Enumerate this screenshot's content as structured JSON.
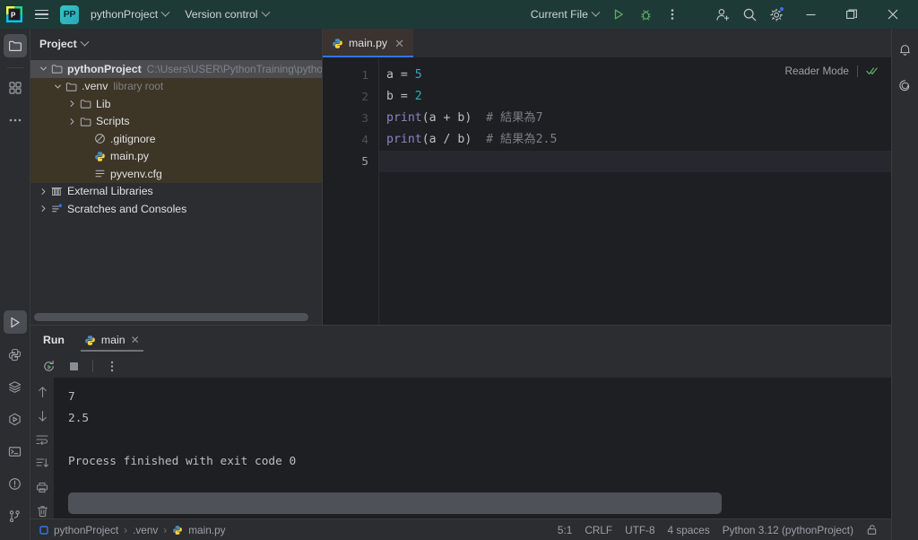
{
  "titlebar": {
    "app_icon": "pycharm-logo-icon",
    "menu_icon": "hamburger-menu-icon",
    "project_badge": "PP",
    "project_name": "pythonProject",
    "version_control": "Version control",
    "run_config": "Current File",
    "run_icon": "run-icon",
    "debug_icon": "debug-icon",
    "more_icon": "more-vertical-icon",
    "account_icon": "add-user-icon",
    "search_icon": "search-icon",
    "settings_icon": "gear-icon",
    "minimize_icon": "minimize-icon",
    "maximize_icon": "maximize-icon",
    "close_icon": "close-icon",
    "accent": "#3574f0",
    "bg": "#1e3a37"
  },
  "left_rail": {
    "top": [
      {
        "name": "project-icon",
        "label": "Project",
        "active": true
      },
      {
        "name": "structure-icon",
        "label": "Structure",
        "active": false
      },
      {
        "name": "more-tools-icon",
        "label": "More tool windows",
        "active": false
      }
    ],
    "bottom": [
      {
        "name": "run-tool-icon",
        "label": "Run",
        "active": true
      },
      {
        "name": "python-console-icon",
        "label": "Python Console",
        "active": false
      },
      {
        "name": "database-icon",
        "label": "Database",
        "active": false
      },
      {
        "name": "services-icon",
        "label": "Services",
        "active": false
      },
      {
        "name": "terminal-icon",
        "label": "Terminal",
        "active": false
      },
      {
        "name": "problems-icon",
        "label": "Problems",
        "active": false
      },
      {
        "name": "version-control-icon",
        "label": "Version Control",
        "active": false
      }
    ]
  },
  "right_rail": [
    {
      "name": "notifications-bell-icon",
      "label": "Notifications"
    },
    {
      "name": "ai-assistant-icon",
      "label": "AI Assistant"
    }
  ],
  "project_panel": {
    "title": "Project",
    "tree": [
      {
        "name": "pythonProject",
        "detail": "C:\\Users\\USER\\PythonTraining\\pythonProject",
        "icon": "folder-icon",
        "indent": 0,
        "expanded": true,
        "selected": true,
        "tint": false
      },
      {
        "name": ".venv",
        "detail": "library root",
        "icon": "folder-icon",
        "indent": 1,
        "expanded": true,
        "selected": false,
        "tint": true
      },
      {
        "name": "Lib",
        "detail": "",
        "icon": "folder-icon",
        "indent": 2,
        "expanded": false,
        "selected": false,
        "tint": true
      },
      {
        "name": "Scripts",
        "detail": "",
        "icon": "folder-icon",
        "indent": 2,
        "expanded": false,
        "selected": false,
        "tint": true
      },
      {
        "name": ".gitignore",
        "detail": "",
        "icon": "gitignore-icon",
        "indent": 3,
        "expanded": null,
        "selected": false,
        "tint": true
      },
      {
        "name": "main.py",
        "detail": "",
        "icon": "python-file-icon",
        "indent": 3,
        "expanded": null,
        "selected": false,
        "tint": true
      },
      {
        "name": "pyvenv.cfg",
        "detail": "",
        "icon": "config-file-icon",
        "indent": 3,
        "expanded": null,
        "selected": false,
        "tint": true
      },
      {
        "name": "External Libraries",
        "detail": "",
        "icon": "libraries-icon",
        "indent": 0,
        "expanded": false,
        "selected": false,
        "tint": false
      },
      {
        "name": "Scratches and Consoles",
        "detail": "",
        "icon": "scratches-icon",
        "indent": 0,
        "expanded": false,
        "selected": false,
        "tint": false
      }
    ]
  },
  "editor": {
    "tab": {
      "label": "main.py",
      "icon": "python-file-icon",
      "close_icon": "close-icon",
      "active": true
    },
    "reader_mode": "Reader Mode",
    "inspection_icon": "inspections-ok-icon",
    "line_numbers": [
      "1",
      "2",
      "3",
      "4",
      "5"
    ],
    "current_line": 5,
    "lines": [
      {
        "n": 1,
        "tokens": [
          {
            "t": "a = ",
            "c": "plain"
          },
          {
            "t": "5",
            "c": "num"
          }
        ]
      },
      {
        "n": 2,
        "tokens": [
          {
            "t": "b = ",
            "c": "plain"
          },
          {
            "t": "2",
            "c": "num"
          }
        ]
      },
      {
        "n": 3,
        "tokens": [
          {
            "t": "print",
            "c": "kw"
          },
          {
            "t": "(a + b)  ",
            "c": "plain"
          },
          {
            "t": "# 結果為7",
            "c": "cmt"
          }
        ]
      },
      {
        "n": 4,
        "tokens": [
          {
            "t": "print",
            "c": "kw"
          },
          {
            "t": "(a / b)  ",
            "c": "plain"
          },
          {
            "t": "# 結果為2.5",
            "c": "cmt"
          }
        ]
      },
      {
        "n": 5,
        "tokens": [
          {
            "t": "",
            "c": "plain"
          }
        ]
      }
    ]
  },
  "run_panel": {
    "title": "Run",
    "tab": {
      "label": "main",
      "icon": "python-file-icon",
      "close_icon": "close-icon"
    },
    "toolbar": [
      {
        "name": "rerun-icon",
        "label": "Rerun"
      },
      {
        "name": "stop-icon",
        "label": "Stop"
      },
      {
        "name": "more-vertical-icon",
        "label": "More"
      }
    ],
    "gutter": [
      {
        "name": "up-arrow-icon",
        "label": "Previous occurrence"
      },
      {
        "name": "down-arrow-icon",
        "label": "Next occurrence"
      },
      {
        "name": "soft-wrap-icon",
        "label": "Soft-Wrap"
      },
      {
        "name": "scroll-to-end-icon",
        "label": "Scroll to end"
      },
      {
        "name": "print-icon",
        "label": "Print"
      },
      {
        "name": "trash-icon",
        "label": "Clear all"
      }
    ],
    "output": [
      "7",
      "2.5",
      "",
      "Process finished with exit code 0"
    ]
  },
  "status_bar": {
    "breadcrumb": [
      {
        "label": "pythonProject",
        "icon": "project-small-icon"
      },
      {
        "label": ".venv",
        "icon": ""
      },
      {
        "label": "main.py",
        "icon": "python-file-icon"
      }
    ],
    "caret": "5:1",
    "line_separator": "CRLF",
    "encoding": "UTF-8",
    "indent": "4 spaces",
    "interpreter": "Python 3.12 (pythonProject)",
    "lock_icon": "unlocked-icon"
  }
}
